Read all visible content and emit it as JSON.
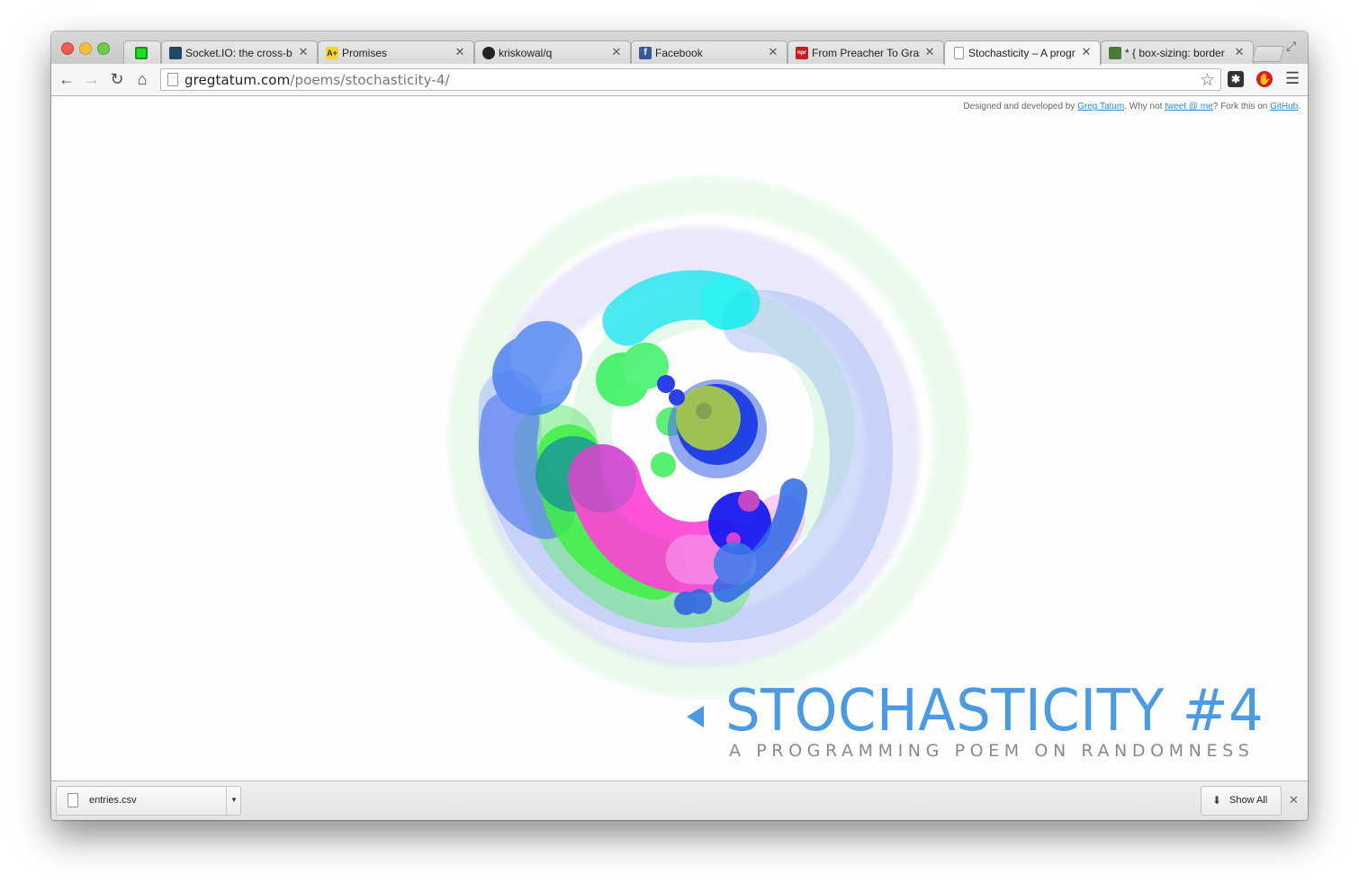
{
  "tabs": [
    {
      "title": "",
      "favicon": "green-square-icon",
      "color": "#22dd22"
    },
    {
      "title": "Socket.IO: the cross-b",
      "favicon": "socketio-icon",
      "color": "#1f4a63"
    },
    {
      "title": "Promises",
      "favicon": "aplus-icon",
      "color": "#f5d623",
      "fav_text": "A+"
    },
    {
      "title": "kriskowal/q",
      "favicon": "github-icon",
      "color": "#222222"
    },
    {
      "title": "Facebook",
      "favicon": "facebook-icon",
      "color": "#3b5998",
      "fav_text": "f"
    },
    {
      "title": "From Preacher To Gras",
      "favicon": "npr-icon",
      "color": "#c41f1f",
      "fav_text": "npr"
    },
    {
      "title": "Stochasticity – A progr",
      "favicon": "page-icon",
      "color": "#ffffff"
    },
    {
      "title": "* { box-sizing: border",
      "favicon": "avatar-icon",
      "color": "#4a7a3a"
    }
  ],
  "active_tab": 6,
  "omnibox": {
    "host": "gregtatum.com",
    "path": "/poems/stochasticity-4/"
  },
  "credits": {
    "prefix": "Designed and developed by ",
    "author": "Greg Tatum",
    "middle": ". Why not ",
    "tweet": "tweet @ me",
    "after_tweet": "? Fork this on ",
    "github": "GitHub",
    "end": "."
  },
  "page": {
    "title": "STOCHASTICITY #4",
    "subtitle": "A PROGRAMMING POEM ON RANDOMNESS",
    "accent_color": "#4a9be6"
  },
  "downloads": {
    "file": "entries.csv",
    "show_all": "Show All"
  }
}
